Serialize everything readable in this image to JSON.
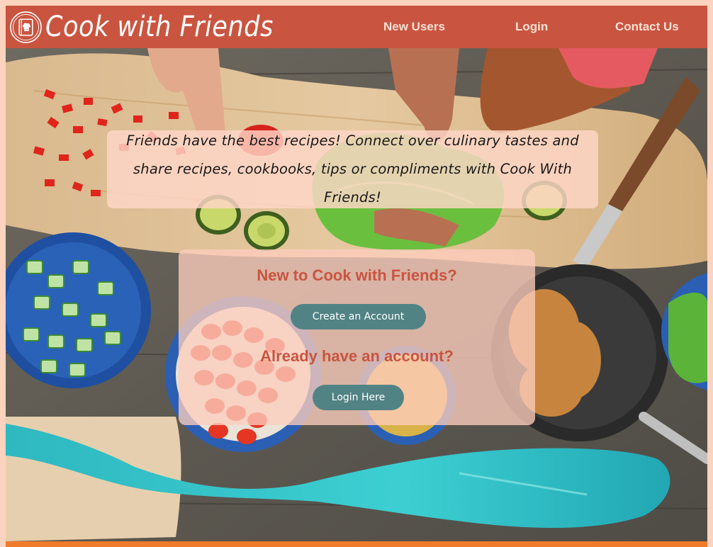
{
  "header": {
    "brand": "Cook with Friends",
    "nav": [
      {
        "label": "New Users"
      },
      {
        "label": "Login"
      },
      {
        "label": "Contact Us"
      }
    ]
  },
  "intro": {
    "text": "Friends have the best recipes! Connect over culinary tastes and share recipes, cookbooks, tips or compliments with Cook With Friends!"
  },
  "account": {
    "new_heading": "New to Cook with Friends?",
    "create_label": "Create an Account",
    "existing_heading": "Already have an account?",
    "login_label": "Login Here"
  },
  "icons": {
    "logo": "cookbook-chef-hat-icon"
  },
  "colors": {
    "header": "#c95540",
    "accent": "#518384",
    "page_bg": "#fcd3bf",
    "footer": "#f07b2a"
  }
}
